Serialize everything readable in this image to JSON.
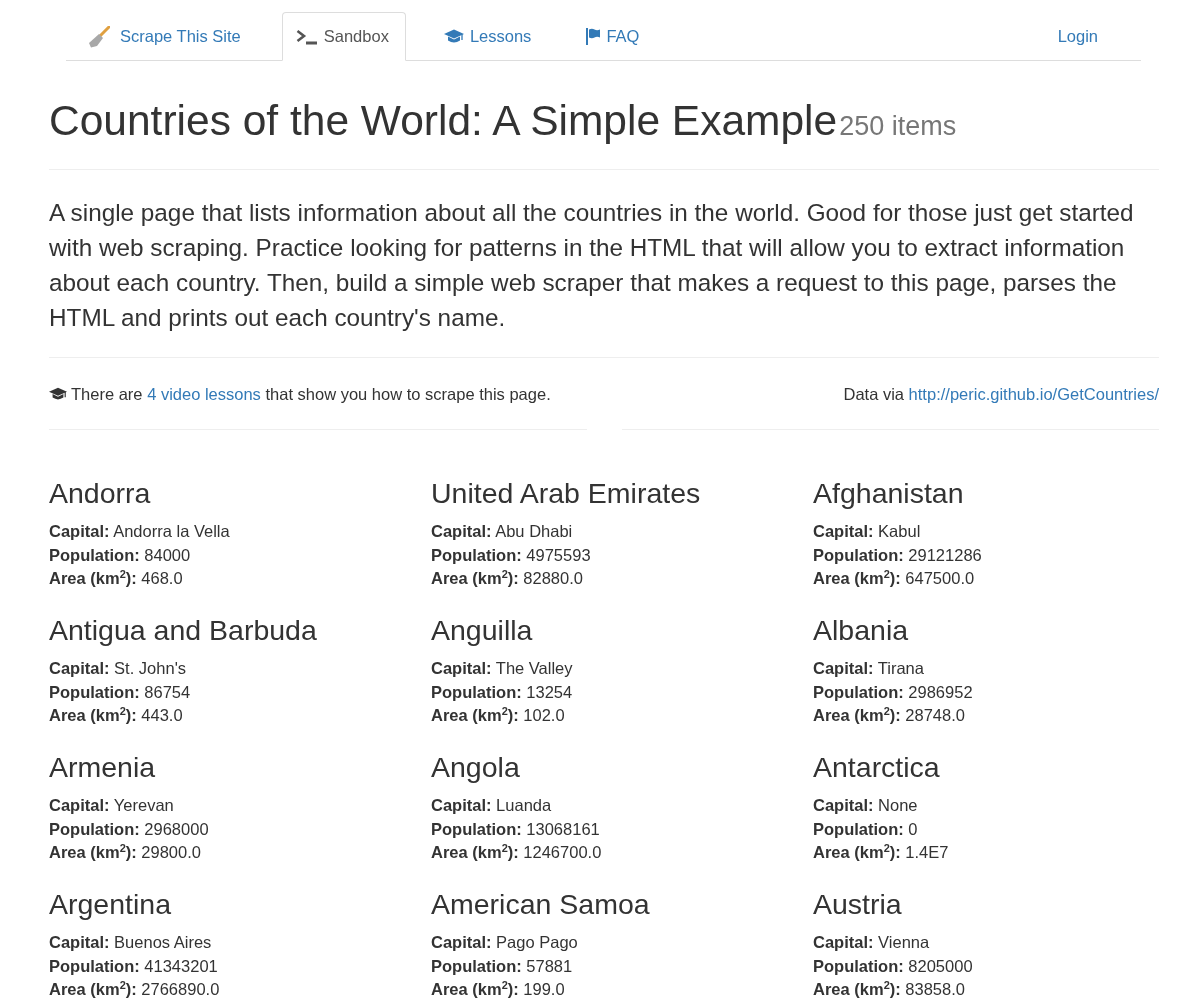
{
  "nav": {
    "tabs": [
      {
        "kind": "brand",
        "label": "Scrape This Site",
        "selected": false
      },
      {
        "kind": "sandbox",
        "label": "Sandbox",
        "selected": true
      },
      {
        "kind": "lessons",
        "label": "Lessons",
        "selected": false
      },
      {
        "kind": "faq",
        "label": "FAQ",
        "selected": false
      }
    ],
    "login": "Login"
  },
  "header": {
    "title": "Countries of the World: A Simple Example",
    "count": "250 items"
  },
  "lead": "A single page that lists information about all the countries in the world. Good for those just get started with web scraping. Practice looking for patterns in the HTML that will allow you to extract information about each country. Then, build a simple web scraper that makes a request to this page, parses the HTML and prints out each country's name.",
  "lessons_note": {
    "before": "There are ",
    "link": "4 video lessons",
    "after": " that show you how to scrape this page."
  },
  "source_note": {
    "label": "Data via",
    "link": "http://peric.github.io/GetCountries/"
  },
  "countries": [
    {
      "name": "Andorra",
      "fields": [
        {
          "label": "Capital:",
          "value": "Andorra la Vella"
        },
        {
          "label": "Population:",
          "value": "84000"
        },
        {
          "label": "Area (km$^{2}$):",
          "value": "468.0"
        }
      ]
    },
    {
      "name": "United Arab Emirates",
      "fields": [
        {
          "label": "Capital:",
          "value": "Abu Dhabi"
        },
        {
          "label": "Population:",
          "value": "4975593"
        },
        {
          "label": "Area (km$^{2}$):",
          "value": "82880.0"
        }
      ]
    },
    {
      "name": "Afghanistan",
      "fields": [
        {
          "label": "Capital:",
          "value": "Kabul"
        },
        {
          "label": "Population:",
          "value": "29121286"
        },
        {
          "label": "Area (km$^{2}$):",
          "value": "647500.0"
        }
      ]
    },
    {
      "name": "Antigua and Barbuda",
      "fields": [
        {
          "label": "Capital:",
          "value": "St. John's"
        },
        {
          "label": "Population:",
          "value": "86754"
        },
        {
          "label": "Area (km$^{2}$):",
          "value": "443.0"
        }
      ]
    },
    {
      "name": "Anguilla",
      "fields": [
        {
          "label": "Capital:",
          "value": "The Valley"
        },
        {
          "label": "Population:",
          "value": "13254"
        },
        {
          "label": "Area (km$^{2}$):",
          "value": "102.0"
        }
      ]
    },
    {
      "name": "Albania",
      "fields": [
        {
          "label": "Capital:",
          "value": "Tirana"
        },
        {
          "label": "Population:",
          "value": "2986952"
        },
        {
          "label": "Area (km$^{2}$):",
          "value": "28748.0"
        }
      ]
    },
    {
      "name": "Armenia",
      "fields": [
        {
          "label": "Capital:",
          "value": "Yerevan"
        },
        {
          "label": "Population:",
          "value": "2968000"
        },
        {
          "label": "Area (km$^{2}$):",
          "value": "29800.0"
        }
      ]
    },
    {
      "name": "Angola",
      "fields": [
        {
          "label": "Capital:",
          "value": "Luanda"
        },
        {
          "label": "Population:",
          "value": "13068161"
        },
        {
          "label": "Area (km$^{2}$):",
          "value": "1246700.0"
        }
      ]
    },
    {
      "name": "Antarctica",
      "fields": [
        {
          "label": "Capital:",
          "value": "None"
        },
        {
          "label": "Population:",
          "value": "0"
        },
        {
          "label": "Area (km$^{2}$):",
          "value": "1.4E7"
        }
      ]
    },
    {
      "name": "Argentina",
      "fields": [
        {
          "label": "Capital:",
          "value": "Buenos Aires"
        },
        {
          "label": "Population:",
          "value": "41343201"
        },
        {
          "label": "Area (km$^{2}$):",
          "value": "2766890.0"
        }
      ]
    },
    {
      "name": "American Samoa",
      "fields": [
        {
          "label": "Capital:",
          "value": "Pago Pago"
        },
        {
          "label": "Population:",
          "value": "57881"
        },
        {
          "label": "Area (km$^{2}$):",
          "value": "199.0"
        }
      ]
    },
    {
      "name": "Austria",
      "fields": [
        {
          "label": "Capital:",
          "value": "Vienna"
        },
        {
          "label": "Population:",
          "value": "8205000"
        },
        {
          "label": "Area (km$^{2}$):",
          "value": "83858.0"
        }
      ]
    }
  ]
}
